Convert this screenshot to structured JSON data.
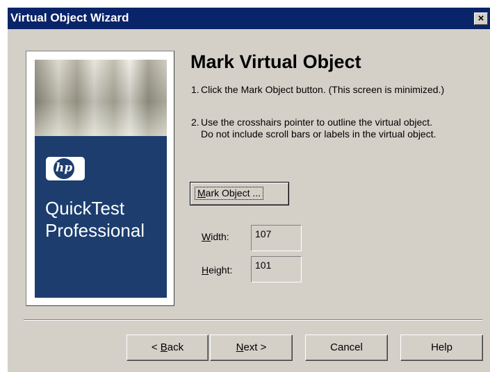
{
  "window": {
    "title": "Virtual Object Wizard",
    "close_label": "×"
  },
  "branding": {
    "logo_text": "hp",
    "product_line1": "QuickTest",
    "product_line2": "Professional"
  },
  "content": {
    "heading": "Mark Virtual Object",
    "step1_num": "1.",
    "step1_text": "Click the Mark Object button. (This screen is minimized.)",
    "step2_num": "2.",
    "step2_line1": "Use the crosshairs pointer to outline the virtual object.",
    "step2_line2": "Do not include scroll bars or labels in the virtual object."
  },
  "mark_button": {
    "hotkey": "M",
    "label_rest": "ark Object ..."
  },
  "fields": {
    "width_hotkey": "W",
    "width_label_rest": "idth:",
    "width_value": "107",
    "height_hotkey": "H",
    "height_label_rest": "eight:",
    "height_value": "101"
  },
  "buttons": {
    "back_prefix": "< ",
    "back_hotkey": "B",
    "back_rest": "ack",
    "next_hotkey": "N",
    "next_rest": "ext >",
    "cancel": "Cancel",
    "help": "Help"
  }
}
